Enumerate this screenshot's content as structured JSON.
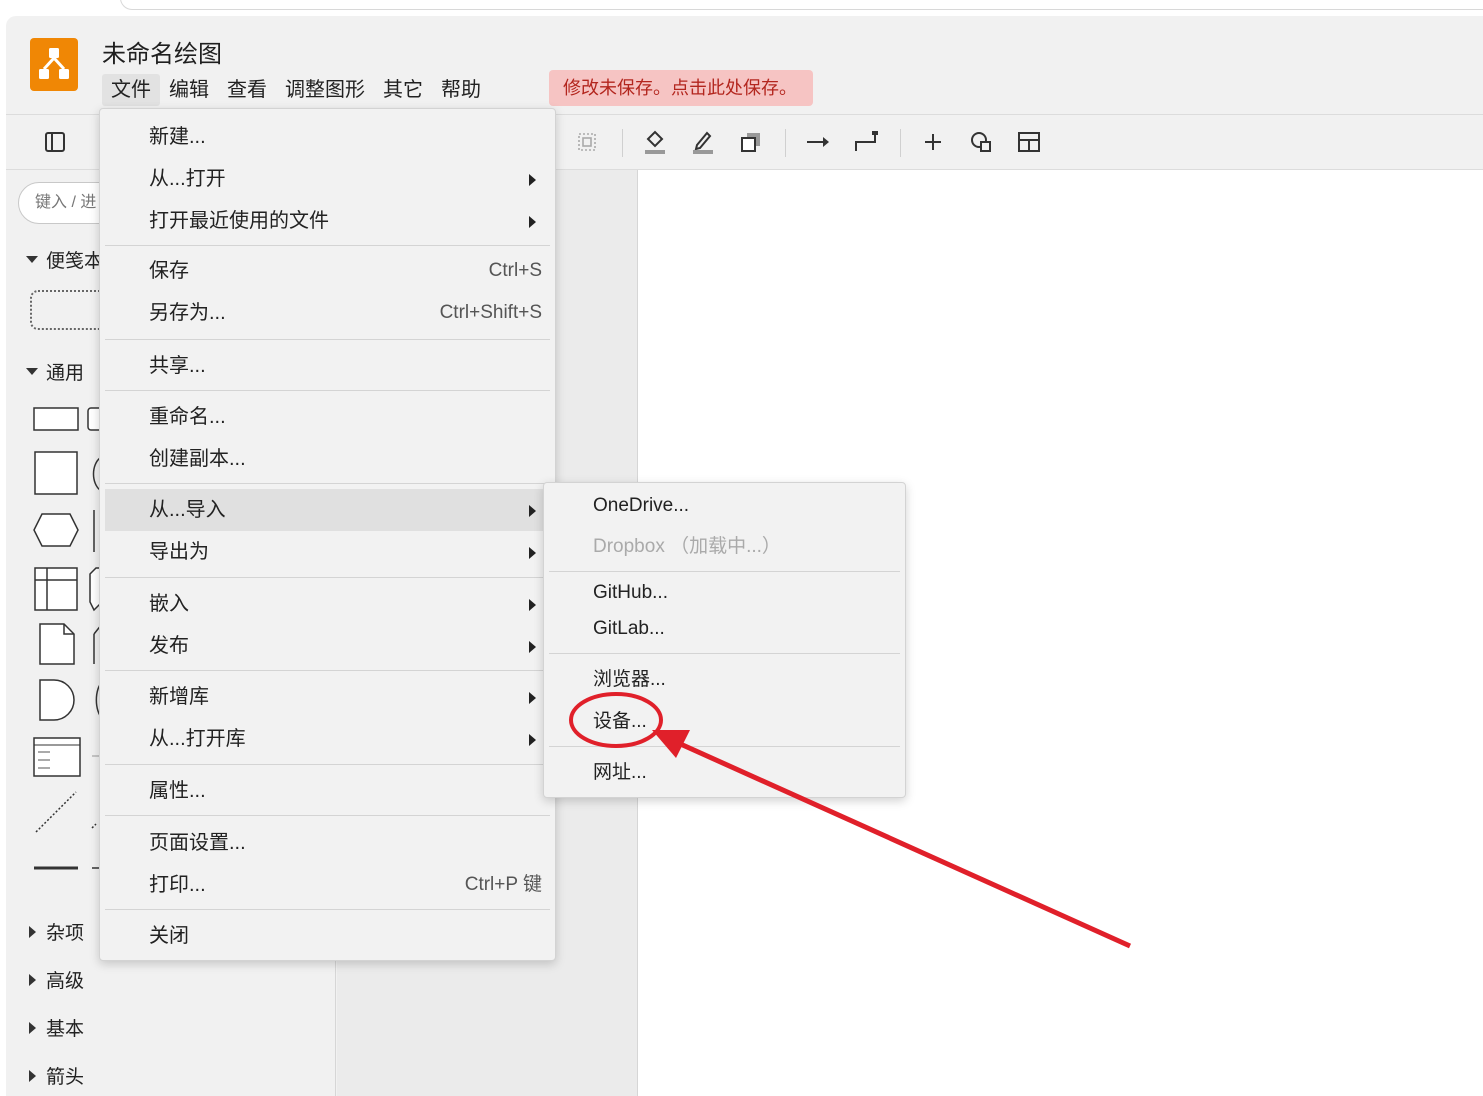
{
  "app": {
    "title": "未命名绘图",
    "unsaved_notice": "修改未保存。点击此处保存。",
    "logo_icon": "drawio-logo-icon",
    "accent_color": "#f08705"
  },
  "menubar": [
    "文件",
    "编辑",
    "查看",
    "调整图形",
    "其它",
    "帮助"
  ],
  "sidebar": {
    "search_placeholder": "键入 / 进",
    "sections": {
      "scratchpad": "便笺本",
      "general": "通用",
      "misc": "杂项",
      "advanced": "高级",
      "basic": "基本",
      "arrows": "箭头"
    }
  },
  "file_menu": {
    "items": [
      {
        "label": "新建...",
        "shortcut": ""
      },
      {
        "label": "从...打开",
        "shortcut": ""
      },
      {
        "label": "打开最近使用的文件",
        "shortcut": ""
      },
      {
        "label": "保存",
        "shortcut": "Ctrl+S"
      },
      {
        "label": "另存为...",
        "shortcut": "Ctrl+Shift+S"
      },
      {
        "label": "共享...",
        "shortcut": ""
      },
      {
        "label": "重命名...",
        "shortcut": ""
      },
      {
        "label": "创建副本...",
        "shortcut": ""
      },
      {
        "label": "从...导入",
        "shortcut": ""
      },
      {
        "label": "导出为",
        "shortcut": ""
      },
      {
        "label": "嵌入",
        "shortcut": ""
      },
      {
        "label": "发布",
        "shortcut": ""
      },
      {
        "label": "新增库",
        "shortcut": ""
      },
      {
        "label": "从...打开库",
        "shortcut": ""
      },
      {
        "label": "属性...",
        "shortcut": ""
      },
      {
        "label": "页面设置...",
        "shortcut": ""
      },
      {
        "label": "打印...",
        "shortcut": "Ctrl+P 键"
      },
      {
        "label": "关闭",
        "shortcut": ""
      }
    ]
  },
  "import_submenu": {
    "items": [
      {
        "label": "OneDrive..."
      },
      {
        "label": "Dropbox （加载中...）"
      },
      {
        "label": "GitHub..."
      },
      {
        "label": "GitLab..."
      },
      {
        "label": "浏览器..."
      },
      {
        "label": "设备..."
      },
      {
        "label": "网址..."
      }
    ]
  },
  "annotation_color": "#e0202a"
}
